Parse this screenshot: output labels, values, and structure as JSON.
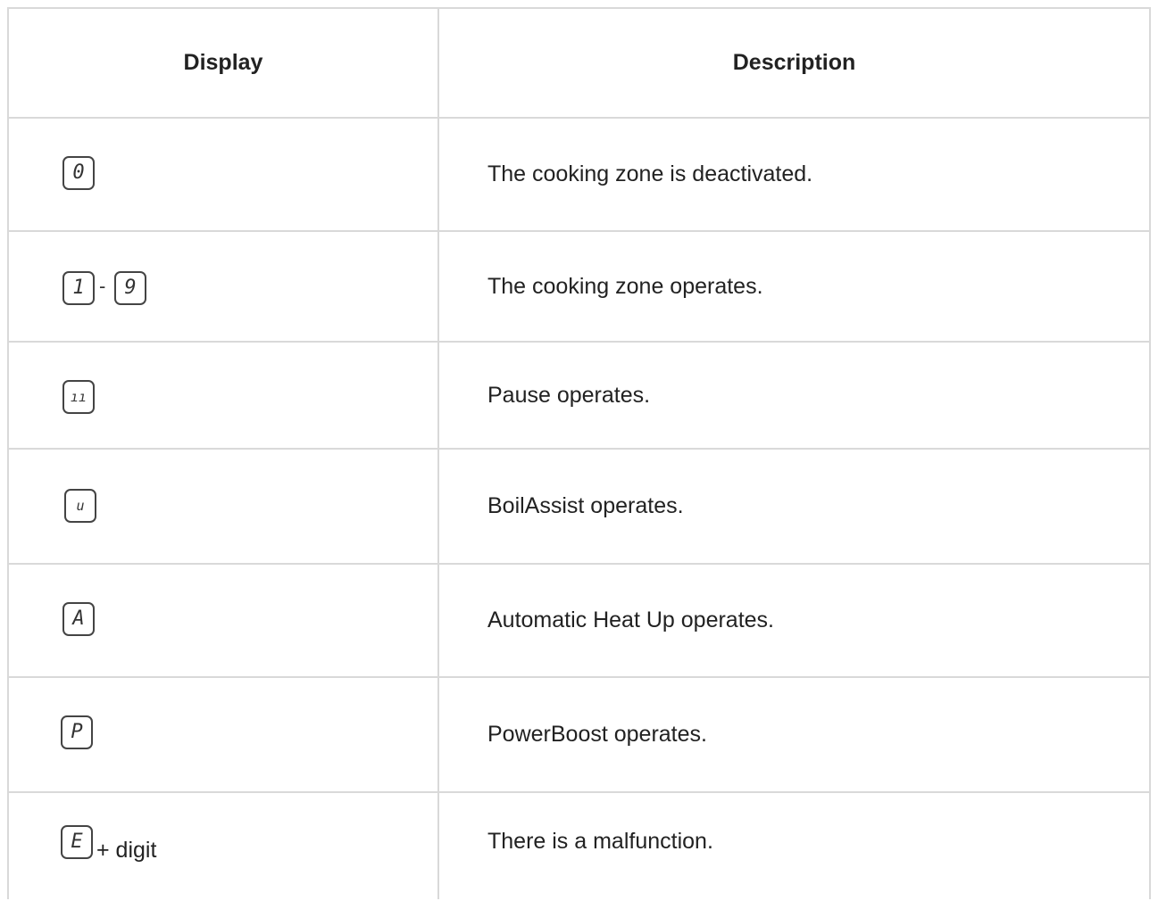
{
  "header": {
    "display": "Display",
    "description": "Description"
  },
  "rows": [
    {
      "glyph": "0",
      "description": "The cooking zone is deactivated."
    },
    {
      "glyph_start": "1",
      "range_sep": "-",
      "glyph_end": "9",
      "description": "The cooking zone operates."
    },
    {
      "glyph": "ıı",
      "description": "Pause operates."
    },
    {
      "glyph": "u",
      "description": "BoilAssist operates."
    },
    {
      "glyph": "A",
      "description": "Automatic Heat Up operates."
    },
    {
      "glyph": "P",
      "description": "PowerBoost operates."
    },
    {
      "glyph": "E",
      "suffix": "+ digit",
      "description": "There is a malfunction."
    }
  ]
}
